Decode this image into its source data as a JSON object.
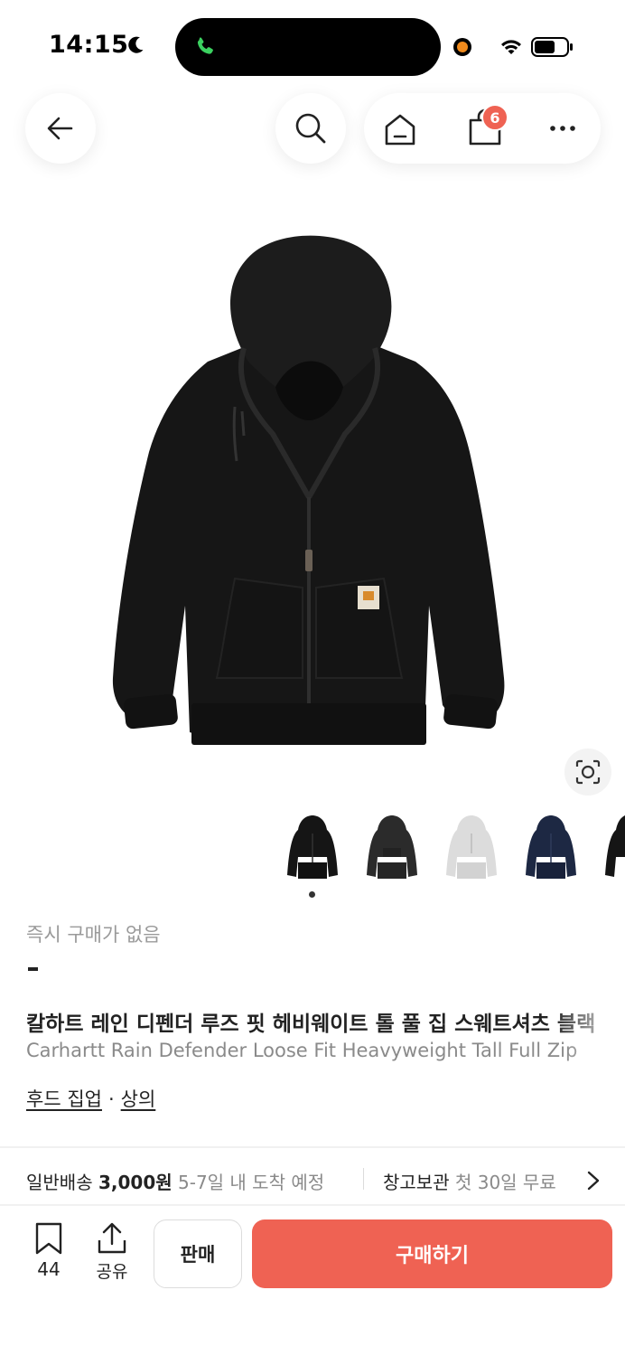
{
  "status_bar": {
    "time": "14:15"
  },
  "header": {
    "cart_badge_count": "6",
    "icons": [
      "back-arrow-icon",
      "search-icon",
      "home-icon",
      "shopping-bag-icon",
      "more-icon"
    ]
  },
  "product": {
    "instant_buy_label": "즉시 구매가 없음",
    "title_ko": "칼하트 레인 디펜더 루즈 핏 헤비웨이트 톨 풀 집 스웨트셔츠 블랙",
    "title_en": "Carhartt Rain Defender Loose Fit Heavyweight Tall Full Zip",
    "categories": [
      "후드 집업",
      "상의"
    ],
    "category_separator": "·",
    "thumbnails": [
      "black-hoodie",
      "charcoal-hoodie",
      "light-gray-hoodie",
      "navy-hoodie",
      "black-hoodie-partial"
    ],
    "current_image_index": 1,
    "image_count_visible_dots": 1
  },
  "shipping": {
    "label": "일반배송",
    "price": "3,000원",
    "eta": "5-7일 내 도착 예정",
    "storage_label": "창고보관",
    "storage_note": "첫 30일 무료"
  },
  "bottom_bar": {
    "bookmark_count": "44",
    "share_label": "공유",
    "sell_label": "판매",
    "buy_label": "구매하기"
  },
  "colors": {
    "accent": "#ef6253",
    "badge": "#ef6253",
    "muted_text": "#8a8a8a"
  }
}
